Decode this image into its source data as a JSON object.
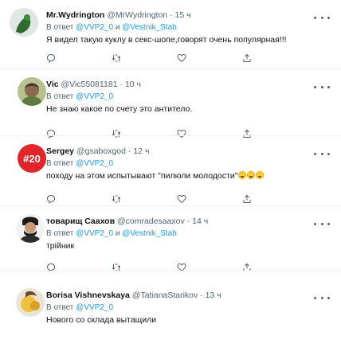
{
  "reply_prefix": "В ответ",
  "and_word": "и",
  "sep": "·",
  "tweets": [
    {
      "name": "Mr.Wydrington",
      "handle": "@MrWydrington",
      "time": "15 ч",
      "reply_to": [
        "@VVP2_0",
        "@Vestnik_Stab"
      ],
      "text": "Я видел такую куклу в секс-шопе,говорят очень популярная!!!"
    },
    {
      "name": "Vic",
      "handle": "@Vic55081181",
      "time": "10 ч",
      "reply_to": [
        "@VVP2_0"
      ],
      "text": "Не знаю какое по счету это антитело."
    },
    {
      "name": "Sergey",
      "handle": "@gsaboxgod",
      "time": "12 ч",
      "reply_to": [
        "@VVP2_0"
      ],
      "text": "походу на этом испытывают \"пилюли молодости\"",
      "avatar_text": "#20"
    },
    {
      "name": "товарищ Саахов",
      "handle": "@comradesaaxov",
      "time": "14 ч",
      "reply_to": [
        "@VVP2_0",
        "@Vestnik_Stab"
      ],
      "text": "трійник"
    },
    {
      "name": "Borisa Vishnevskaya",
      "handle": "@TatianaStarikov",
      "time": "13 ч",
      "reply_to": [
        "@VVP2_0"
      ],
      "text": "Нового со склада вытащили"
    }
  ],
  "icons": {
    "reply": "reply-icon",
    "retweet": "retweet-icon",
    "like": "heart-icon",
    "share": "share-icon",
    "more": "more-icon"
  },
  "colors": {
    "accent": "#1d9bf0",
    "secondary": "#536471",
    "divider": "#eff3f4"
  }
}
